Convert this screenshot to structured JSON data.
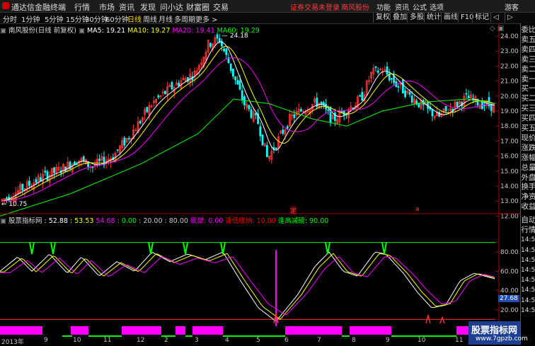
{
  "titlebar": {
    "app_name": "通达信金融终端",
    "menus": [
      "行情",
      "市场",
      "资讯",
      "发现",
      "问小达",
      "财富圈",
      "交易"
    ],
    "notice": "证券交易未登录",
    "stock": "南风股份",
    "right_menus": [
      "功能",
      "资讯",
      "公式",
      "选项",
      "游客"
    ]
  },
  "toolbar": {
    "periods": [
      "分时",
      "1分钟",
      "5分钟",
      "15分钟",
      "30分钟",
      "60分钟",
      "日线",
      "周线",
      "月线",
      "多周期",
      "更多 >"
    ],
    "active": "日线",
    "right_buttons": [
      "复权",
      "叠加",
      "多股",
      "统计",
      "画线",
      "F10",
      "标记",
      "◁",
      "▷"
    ]
  },
  "price_panel": {
    "title": "南风股份(日线 前复权)",
    "ma": [
      {
        "label": "MA5: 19.21",
        "color": "#ffffff"
      },
      {
        "label": "MA10: 19.27",
        "color": "#ffff00"
      },
      {
        "label": "MA20: 19.41",
        "color": "#ff00ff"
      },
      {
        "label": "MA60: 19.29",
        "color": "#00ff00"
      }
    ],
    "high_label": "24.18",
    "low_label": "10.75",
    "event_markers": [
      "定",
      "a"
    ],
    "y_ticks": [
      "24.00",
      "23.00",
      "22.00",
      "21.00",
      "20.00",
      "19.00",
      "18.00",
      "17.00",
      "16.00",
      "15.00",
      "14.00",
      "13.00",
      "12.00"
    ]
  },
  "indicator_panel": {
    "title": "股票指标网",
    "values": [
      {
        "label": ": 52.88",
        "color": "#ffffff"
      },
      {
        "label": ": 53.53",
        "color": "#ffff00"
      },
      {
        "label": "54.68",
        "color": "#ff00ff"
      },
      {
        "label": ": 0.00",
        "color": "#00ff00"
      },
      {
        "label": ": 20.00",
        "color": "#cccccc"
      },
      {
        "label": ": 80.00",
        "color": "#cccccc"
      },
      {
        "label": "底部: 0.00",
        "color": "#ff00ff"
      },
      {
        "label": "逢低吸纳: 10.00",
        "color": "#ff0000"
      },
      {
        "label": "逢高减磅: 90.00",
        "color": "#00ff00"
      }
    ],
    "y_ticks": [
      "80.00",
      "60.00",
      "40.00",
      "20.00",
      "0.00"
    ],
    "current_value": "27.68"
  },
  "sidebar_top": [
    "委比",
    "卖五",
    "卖四",
    "卖三",
    "卖二",
    "卖一",
    "买一",
    "买二",
    "买三",
    "买四",
    "买五",
    "现价",
    "涨跌",
    "涨幅",
    "总量",
    "外盘",
    "换手",
    "净资",
    "收益"
  ],
  "sidebar_bottom": [
    "自动",
    "行情",
    "14:50",
    "14:50",
    "14:50",
    "14:50",
    "14:50",
    "14:50",
    "14:50",
    "14:50"
  ],
  "time_axis": [
    "2013年",
    "9",
    "10",
    "11",
    "12",
    "2",
    "3",
    "4",
    "5",
    "6",
    "7",
    "8",
    "9",
    "10",
    "11"
  ],
  "watermark": {
    "title": "股票指标网",
    "url": "www.7gpzb.com"
  },
  "colors": {
    "up": "#ff3232",
    "down": "#00ffff",
    "ma5": "#ffffff",
    "ma10": "#ffff00",
    "ma20": "#ff00ff",
    "ma60": "#00ff00",
    "signal_green": "#00ff00",
    "signal_magenta": "#ff00ff"
  }
}
